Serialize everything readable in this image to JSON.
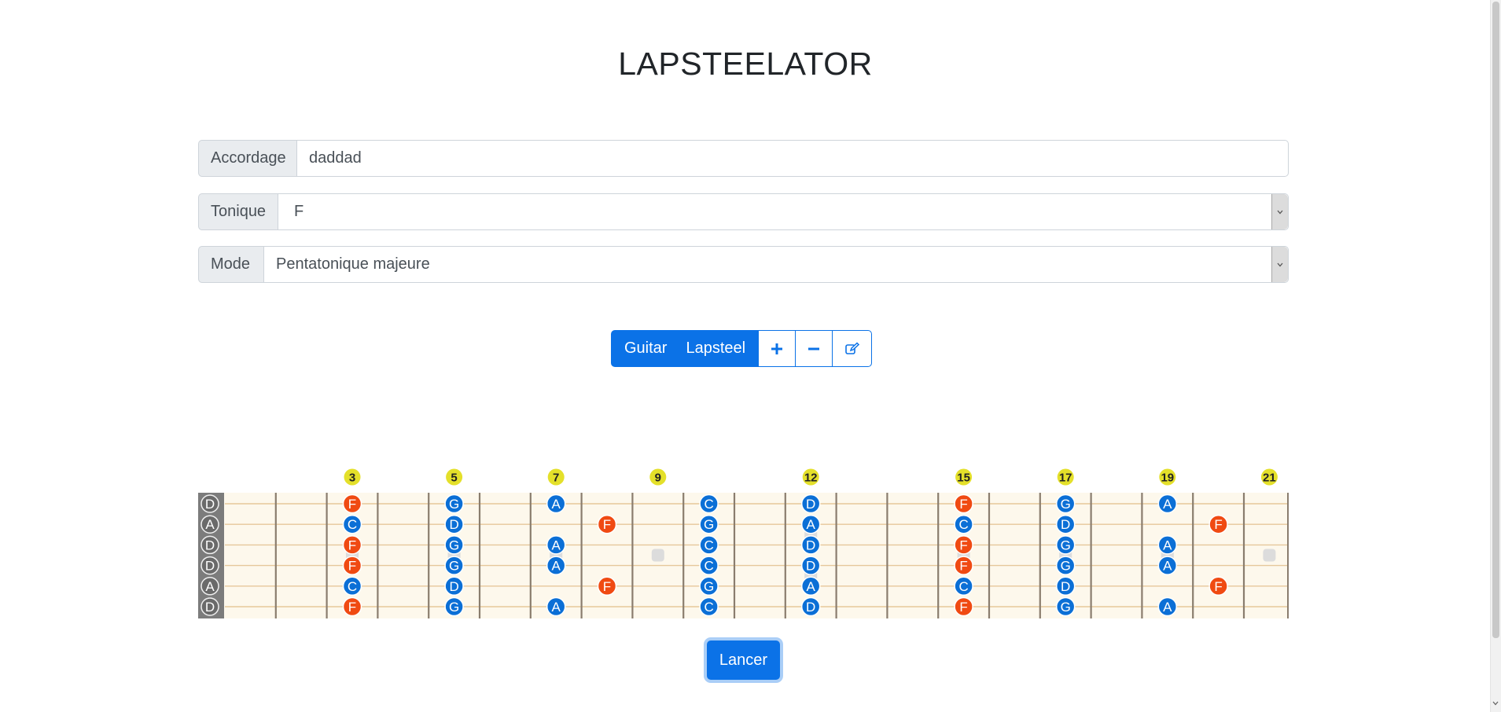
{
  "app": {
    "title": "LAPSTEELATOR"
  },
  "form": {
    "tuning": {
      "label": "Accordage",
      "value": "daddad"
    },
    "tonic": {
      "label": "Tonique",
      "value": "F"
    },
    "mode": {
      "label": "Mode",
      "value": "Pentatonique majeure"
    }
  },
  "toolbar": {
    "guitar_label": "Guitar",
    "lapsteel_label": "Lapsteel",
    "add_icon": "plus-icon",
    "remove_icon": "minus-icon",
    "edit_icon": "edit-icon"
  },
  "fretboard": {
    "strings": [
      "D",
      "A",
      "D",
      "D",
      "A",
      "D"
    ],
    "fret_markers": [
      "3",
      "5",
      "7",
      "9",
      "12",
      "15",
      "17",
      "19",
      "21"
    ],
    "notes": [
      {
        "string": 0,
        "fret": 3,
        "note": "F",
        "root": true
      },
      {
        "string": 0,
        "fret": 5,
        "note": "G",
        "root": false
      },
      {
        "string": 0,
        "fret": 7,
        "note": "A",
        "root": false
      },
      {
        "string": 0,
        "fret": 10,
        "note": "C",
        "root": false
      },
      {
        "string": 0,
        "fret": 12,
        "note": "D",
        "root": false
      },
      {
        "string": 0,
        "fret": 15,
        "note": "F",
        "root": true
      },
      {
        "string": 0,
        "fret": 17,
        "note": "G",
        "root": false
      },
      {
        "string": 0,
        "fret": 19,
        "note": "A",
        "root": false
      },
      {
        "string": 1,
        "fret": 3,
        "note": "C",
        "root": false
      },
      {
        "string": 1,
        "fret": 5,
        "note": "D",
        "root": false
      },
      {
        "string": 1,
        "fret": 8,
        "note": "F",
        "root": true
      },
      {
        "string": 1,
        "fret": 10,
        "note": "G",
        "root": false
      },
      {
        "string": 1,
        "fret": 12,
        "note": "A",
        "root": false
      },
      {
        "string": 1,
        "fret": 15,
        "note": "C",
        "root": false
      },
      {
        "string": 1,
        "fret": 17,
        "note": "D",
        "root": false
      },
      {
        "string": 1,
        "fret": 20,
        "note": "F",
        "root": true
      },
      {
        "string": 2,
        "fret": 3,
        "note": "F",
        "root": true
      },
      {
        "string": 2,
        "fret": 5,
        "note": "G",
        "root": false
      },
      {
        "string": 2,
        "fret": 7,
        "note": "A",
        "root": false
      },
      {
        "string": 2,
        "fret": 10,
        "note": "C",
        "root": false
      },
      {
        "string": 2,
        "fret": 12,
        "note": "D",
        "root": false
      },
      {
        "string": 2,
        "fret": 15,
        "note": "F",
        "root": true
      },
      {
        "string": 2,
        "fret": 17,
        "note": "G",
        "root": false
      },
      {
        "string": 2,
        "fret": 19,
        "note": "A",
        "root": false
      },
      {
        "string": 3,
        "fret": 3,
        "note": "F",
        "root": true
      },
      {
        "string": 3,
        "fret": 5,
        "note": "G",
        "root": false
      },
      {
        "string": 3,
        "fret": 7,
        "note": "A",
        "root": false
      },
      {
        "string": 3,
        "fret": 10,
        "note": "C",
        "root": false
      },
      {
        "string": 3,
        "fret": 12,
        "note": "D",
        "root": false
      },
      {
        "string": 3,
        "fret": 15,
        "note": "F",
        "root": true
      },
      {
        "string": 3,
        "fret": 17,
        "note": "G",
        "root": false
      },
      {
        "string": 3,
        "fret": 19,
        "note": "A",
        "root": false
      },
      {
        "string": 4,
        "fret": 3,
        "note": "C",
        "root": false
      },
      {
        "string": 4,
        "fret": 5,
        "note": "D",
        "root": false
      },
      {
        "string": 4,
        "fret": 8,
        "note": "F",
        "root": true
      },
      {
        "string": 4,
        "fret": 10,
        "note": "G",
        "root": false
      },
      {
        "string": 4,
        "fret": 12,
        "note": "A",
        "root": false
      },
      {
        "string": 4,
        "fret": 15,
        "note": "C",
        "root": false
      },
      {
        "string": 4,
        "fret": 17,
        "note": "D",
        "root": false
      },
      {
        "string": 4,
        "fret": 20,
        "note": "F",
        "root": true
      },
      {
        "string": 5,
        "fret": 3,
        "note": "F",
        "root": true
      },
      {
        "string": 5,
        "fret": 5,
        "note": "G",
        "root": false
      },
      {
        "string": 5,
        "fret": 7,
        "note": "A",
        "root": false
      },
      {
        "string": 5,
        "fret": 10,
        "note": "C",
        "root": false
      },
      {
        "string": 5,
        "fret": 12,
        "note": "D",
        "root": false
      },
      {
        "string": 5,
        "fret": 15,
        "note": "F",
        "root": true
      },
      {
        "string": 5,
        "fret": 17,
        "note": "G",
        "root": false
      },
      {
        "string": 5,
        "fret": 19,
        "note": "A",
        "root": false
      }
    ],
    "colors": {
      "root": "#f04a12",
      "scale": "#0b6fd6",
      "marker": "#e4e02a",
      "board": "#fdf8ec",
      "nut": "#7c7c7c"
    }
  },
  "launch": {
    "label": "Lancer"
  }
}
